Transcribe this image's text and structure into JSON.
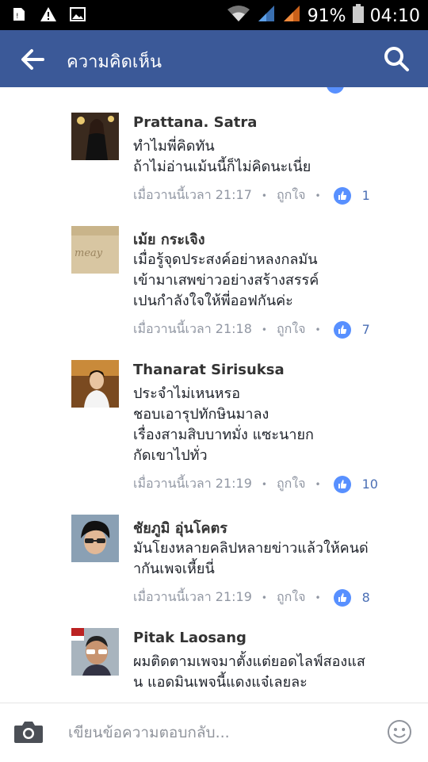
{
  "status_bar": {
    "battery": "91%",
    "time": "04:10"
  },
  "header": {
    "title": "ความคิดเห็น"
  },
  "comments": [
    {
      "name": "Prattana. Satra",
      "lines": [
        "ทำไมพี่คิดทัน",
        "ถ้าไม่อ่านเม้นนี้ก็ไม่คิดนะเนี่ย"
      ],
      "time": "เมื่อวานนี้เวลา 21:17",
      "like_label": "ถูกใจ",
      "like_count": "1"
    },
    {
      "name": "เม้ย กระเจิง",
      "lines": [
        "เมื่อรู้จุดประสงค์อย่าหลงกลมัน",
        "เข้ามาเสพข่าวอย่างสร้างสรรค์",
        "เปนกำลังใจให้พี่ออฟกันค่ะ"
      ],
      "time": "เมื่อวานนี้เวลา 21:18",
      "like_label": "ถูกใจ",
      "like_count": "7"
    },
    {
      "name": "Thanarat Sirisuksa",
      "lines": [
        "ประจำไม่เหนหรอ",
        "ชอบเอารุปทักษินมาลง",
        "เรื่องสามสิบบาทมั่ง แซะนายก",
        "กัดเขาไปทั่ว"
      ],
      "time": "เมื่อวานนี้เวลา 21:19",
      "like_label": "ถูกใจ",
      "like_count": "10"
    },
    {
      "name": "ชัยภูมิ อุ่นโคตร",
      "lines": [
        "มันโยงหลายคลิปหลายข่าวแล้วให้คนด่",
        "ากันเพจเหี้ยนี่"
      ],
      "time": "เมื่อวานนี้เวลา 21:19",
      "like_label": "ถูกใจ",
      "like_count": "8"
    },
    {
      "name": "Pitak Laosang",
      "lines": [
        "ผมติดตามเพจมาตั้งแต่ยอดไลฟ์สองแส",
        "น แอดมินเพจนี้แดงแจ๋เลยละ"
      ]
    }
  ],
  "composer": {
    "placeholder": "เขียนข้อความตอบกลับ..."
  },
  "colors": {
    "header_bg": "#3b5998",
    "like_blue": "#5890ff",
    "meta_gray": "#9197a3"
  },
  "icons": [
    "back-arrow-icon",
    "search-icon",
    "camera-icon",
    "smiley-icon",
    "thumbs-up-icon"
  ]
}
